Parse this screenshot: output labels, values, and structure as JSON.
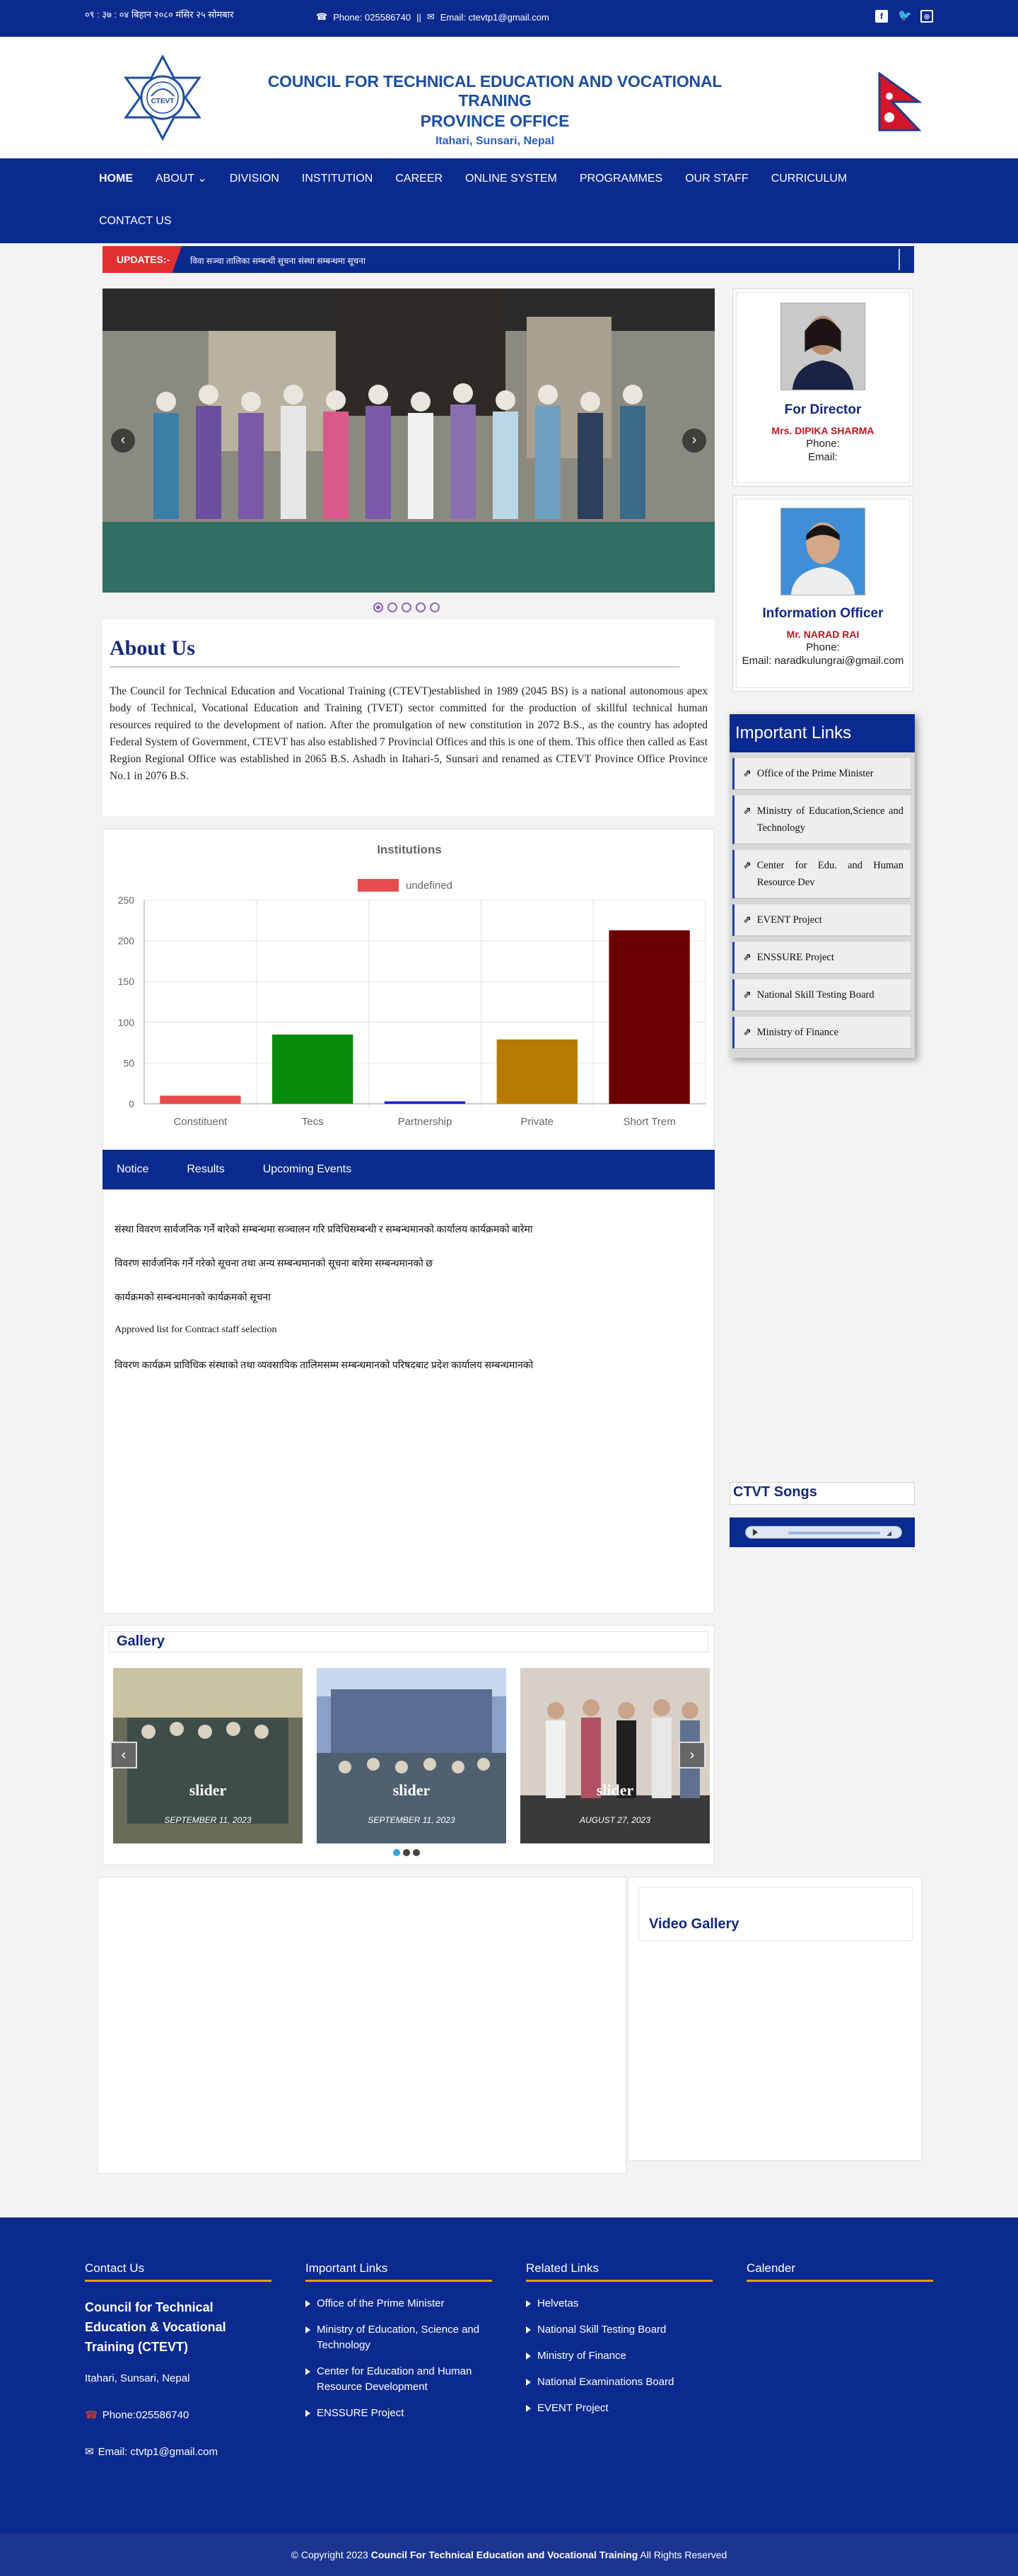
{
  "topbar": {
    "date": "०९ : ३७ : ०४ बिहान   २०८० मंसिर २५ सोमबार",
    "phone": "Phone: 025586740",
    "separator": "||",
    "email": "Email: ctevtp1@gmail.com",
    "social_icons": [
      "facebook-icon",
      "twitter-icon",
      "instagram-icon"
    ]
  },
  "header": {
    "title_line1": "COUNCIL FOR TECHNICAL EDUCATION AND VOCATIONAL TRANING",
    "title_line2": "PROVINCE OFFICE",
    "location": "Itahari, Sunsari, Nepal",
    "logo_text": "CTEVT"
  },
  "nav": {
    "items": [
      "HOME",
      "ABOUT",
      "DIVISION",
      "INSTITUTION",
      "CAREER",
      "ONLINE SYSTEM",
      "PROGRAMMES",
      "OUR STAFF",
      "CURRICULUM",
      "CONTACT US"
    ]
  },
  "ticker": {
    "label": "UPDATES:-",
    "text": "विवा सञ्चा तालिका सम्बन्धी सूचना संस्था सम्बन्धमा सूचना"
  },
  "slider": {
    "prev": "‹",
    "next": "›"
  },
  "about": {
    "heading": "About Us",
    "body": "The Council for Technical Education and Vocational Training (CTEVT)established in 1989 (2045 BS) is a national autonomous apex body of Technical, Vocational Education and Training (TVET) sector committed for the production of skillful technical human resources required to the development of nation. After the promulgation of new constitution in 2072 B.S., as the country has adopted Federal System of Government, CTEVT has also established 7 Provincial Offices and this is one of them. This office then called as East Region Regional Office was established in 2065 B.S. Ashadh in Itahari-5, Sunsari and renamed as CTEVT Province Office Province No.1 in 2076 B.S."
  },
  "chart_data": {
    "type": "bar",
    "title": "Institutions",
    "legend": "undefined",
    "legend_placement": "top",
    "categories": [
      "Constituent",
      "Tecs",
      "Partnership",
      "Private",
      "Short Trem"
    ],
    "values": [
      10,
      85,
      3,
      79,
      213
    ],
    "colors": [
      "#e84c4c",
      "#0a8a0a",
      "#1f1fd0",
      "#b87a00",
      "#6b0000"
    ],
    "ylim": [
      0,
      250
    ],
    "yticks": [
      0,
      50,
      100,
      150,
      200,
      250
    ],
    "grid": true
  },
  "tabs": [
    "Notice",
    "Results",
    "Upcoming Events"
  ],
  "notices": [
    "संस्था विवरण सार्वजनिक गर्ने बारेको सम्बन्धमा सञ्चालन गरि प्रविधिसम्बन्धी र सम्बन्धमानको कार्यालय कार्यक्रमको बारेमा",
    "विवरण सार्वजनिक गर्ने गरेको सूचना तथा अन्य सम्बन्धमानको  सूचना बारेमा सम्बन्धमानको छ",
    "कार्यक्रमको सम्बन्धमानको कार्यक्रमको सूचना",
    "Approved list for Contract staff selection",
    "विवरण कार्यक्रम प्राविधिक संस्थाको तथा व्यवसायिक तालिमसम्म सम्बन्धमानको परिषदबाट प्रदेश कार्यालय सम्बन्धमानको"
  ],
  "gallery": {
    "title": "Gallery",
    "items": [
      {
        "caption": "slider",
        "date": "SEPTEMBER 11, 2023"
      },
      {
        "caption": "slider",
        "date": "SEPTEMBER 11, 2023"
      },
      {
        "caption": "slider",
        "date": "AUGUST 27, 2023"
      }
    ],
    "prev": "‹",
    "next": "›"
  },
  "director": {
    "role": "For Director",
    "name": "Mrs. DIPIKA SHARMA",
    "phone": "Phone:",
    "email": "Email:"
  },
  "info_officer": {
    "role": "Information Officer",
    "name": "Mr. NARAD RAI",
    "phone": "Phone:",
    "email": "Email: naradkulungrai@gmail.com"
  },
  "important_links": {
    "title": "Important Links",
    "items": [
      "Office of the Prime Minister",
      "Ministry of Education,Science and Technology",
      "Center for Edu. and Human Resource Dev",
      "EVENT Project",
      "ENSSURE Project",
      "National Skill Testing Board",
      "Ministry of Finance"
    ]
  },
  "songs": {
    "title": "CTVT Songs"
  },
  "video": {
    "title": "Video Gallery"
  },
  "footer": {
    "contact": {
      "heading": "Contact Us",
      "org": "Council for Technical Education & Vocational Training (CTEVT)",
      "address": "Itahari, Sunsari, Nepal",
      "phone": "Phone:025586740",
      "email": "Email: ctvtp1@gmail.com"
    },
    "important": {
      "heading": "Important Links",
      "items": [
        "Office of the Prime Minister",
        "Ministry of Education, Science and Technology",
        "Center for Education and Human Resource Development",
        "ENSSURE Project"
      ]
    },
    "related": {
      "heading": "Related Links",
      "items": [
        "Helvetas",
        "National Skill Testing Board",
        "Ministry of Finance",
        "National Examinations Board",
        "EVENT Project"
      ]
    },
    "calendar": {
      "heading": "Calender"
    }
  },
  "copyright": {
    "prefix": "© Copyright 2023",
    "org": "Council For Technical Education and Vocational Training",
    "suffix": "All Rights Reserved"
  },
  "colors": {
    "brand_blue": "#0b2a8f",
    "accent_red": "#c0141e",
    "accent_gold": "#e0a200"
  }
}
